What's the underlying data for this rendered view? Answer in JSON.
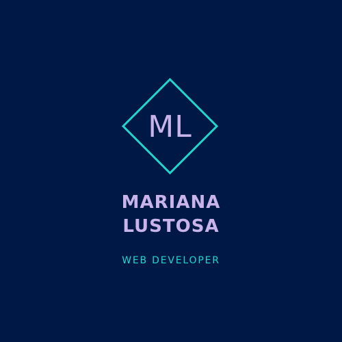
{
  "logo": {
    "monogram": "ML",
    "name_line_1": "MARIANA",
    "name_line_2": "LUSTOSA",
    "tagline": "WEB DEVELOPER"
  },
  "colors": {
    "background": "#001845",
    "accent": "#1ed6cf",
    "text_primary": "#c8b3ea"
  },
  "icons": {
    "frame": "diamond-frame-icon"
  }
}
